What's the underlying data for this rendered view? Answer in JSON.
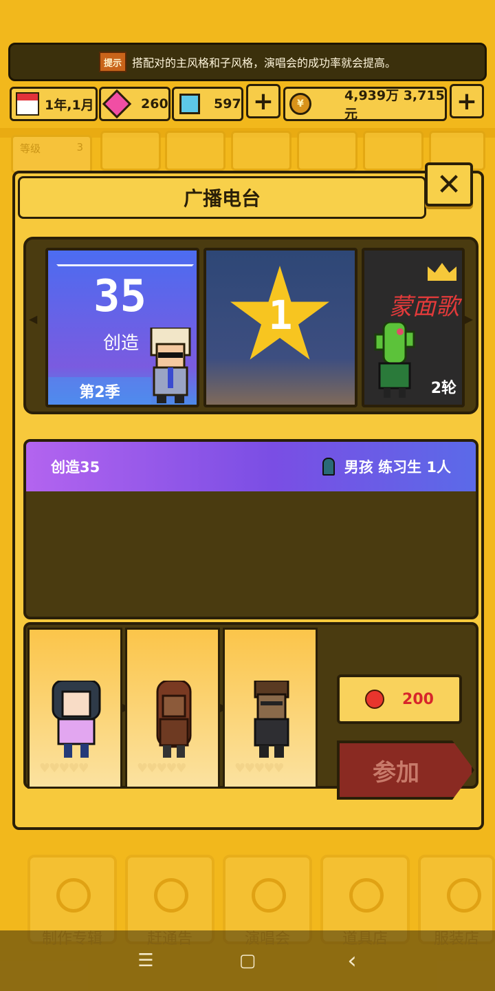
{
  "hint": {
    "icon_text": "提示",
    "text": "搭配对的主风格和子风格，演唱会的成功率就会提高。"
  },
  "resources": {
    "date": "1年,1月",
    "pink_gems": "260",
    "blue_gems": "597",
    "money": "4,939万 3,715元",
    "plus_symbol": "+"
  },
  "background": {
    "level_label": "等级",
    "level_value": "3",
    "nav": [
      "制作专辑",
      "赶通告",
      "演唱会",
      "道具店",
      "服装店"
    ]
  },
  "panel": {
    "title": "广播电台",
    "close_symbol": "✕",
    "cards": [
      {
        "number": "35",
        "subtitle": "创造",
        "season": "第2季"
      },
      {
        "number": "1"
      },
      {
        "title": "蒙面歌",
        "round": "2轮"
      }
    ],
    "detail": {
      "show_name": "创造35",
      "requirement": "男孩 练习生 1人"
    },
    "lineup": {
      "hearts": "♥♥♥♥♥",
      "cost": "200",
      "join_label": "参加"
    }
  },
  "system_nav": {
    "menu": "☰",
    "home": "▢",
    "back": "‹"
  },
  "colors": {
    "panel": "#f7c93c",
    "dark": "#2a1f08",
    "purple": "#8a5ae8",
    "join": "#8a2a22"
  }
}
